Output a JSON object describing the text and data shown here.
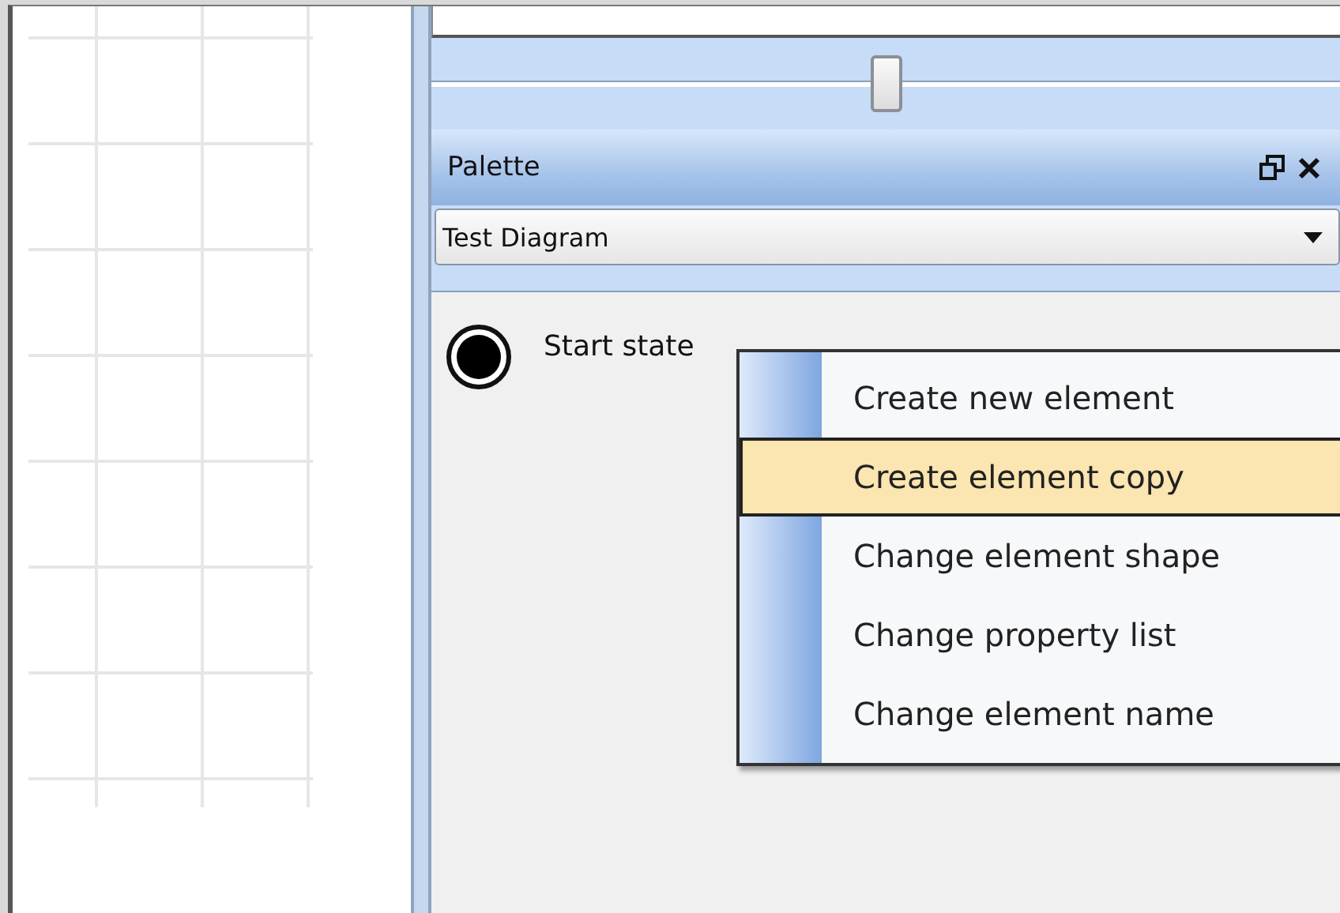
{
  "slider": {
    "level": 0.5
  },
  "palette": {
    "title": "Palette",
    "diagram_select": {
      "value": "Test Diagram"
    },
    "items": [
      {
        "label": "Start state"
      }
    ]
  },
  "context_menu": {
    "items": [
      {
        "label": "Create new element",
        "selected": false
      },
      {
        "label": "Create element copy",
        "selected": true
      },
      {
        "label": "Change element shape",
        "selected": false
      },
      {
        "label": "Change property list",
        "selected": false
      },
      {
        "label": "Change element name",
        "selected": false
      }
    ]
  }
}
